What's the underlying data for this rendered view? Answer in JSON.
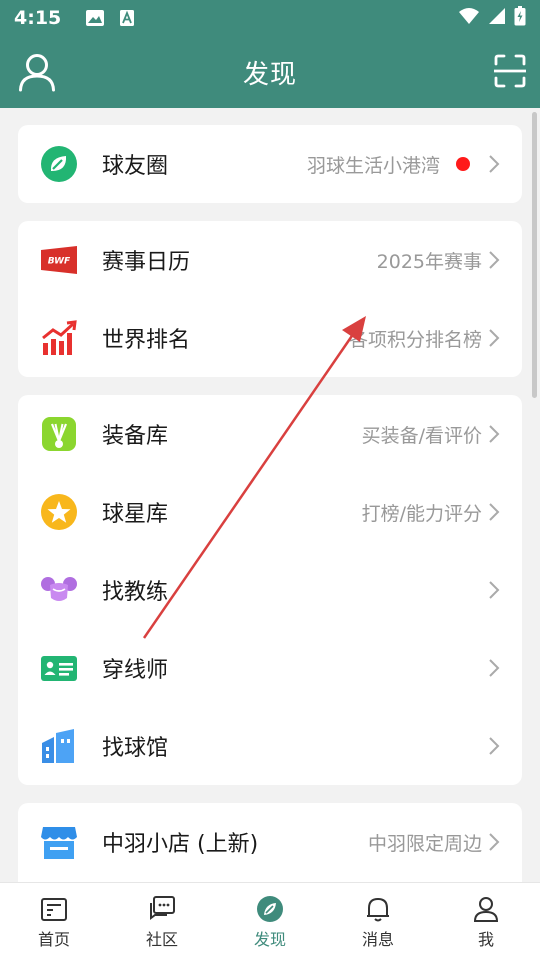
{
  "status_bar": {
    "time": "4:15"
  },
  "header": {
    "title": "发现"
  },
  "cards": [
    {
      "rows": [
        {
          "label": "球友圈",
          "sub": "羽球生活小港湾",
          "icon": "leaf-circle-icon",
          "badge": true
        }
      ]
    },
    {
      "rows": [
        {
          "label": "赛事日历",
          "sub": "2025年赛事",
          "icon": "bwf-logo-icon"
        },
        {
          "label": "世界排名",
          "sub": "各项积分排名榜",
          "icon": "ranking-chart-icon"
        }
      ]
    },
    {
      "rows": [
        {
          "label": "装备库",
          "sub": "买装备/看评价",
          "icon": "shuttlecock-icon"
        },
        {
          "label": "球星库",
          "sub": "打榜/能力评分",
          "icon": "star-circle-icon"
        },
        {
          "label": "找教练",
          "sub": "",
          "icon": "muscle-icon"
        },
        {
          "label": "穿线师",
          "sub": "",
          "icon": "id-card-icon"
        },
        {
          "label": "找球馆",
          "sub": "",
          "icon": "building-icon"
        }
      ]
    },
    {
      "rows": [
        {
          "label": "中羽小店 (上新)",
          "sub": "中羽限定周边",
          "icon": "shop-icon"
        }
      ]
    }
  ],
  "tabs": [
    {
      "label": "首页",
      "icon": "home-news-icon"
    },
    {
      "label": "社区",
      "icon": "community-chat-icon"
    },
    {
      "label": "发现",
      "icon": "discover-compass-icon",
      "active": true
    },
    {
      "label": "消息",
      "icon": "bell-icon"
    },
    {
      "label": "我",
      "icon": "person-icon"
    }
  ],
  "colors": {
    "primary": "#3f8b7c",
    "badge": "#ff1a1a",
    "annotation_arrow": "#d9403f"
  }
}
